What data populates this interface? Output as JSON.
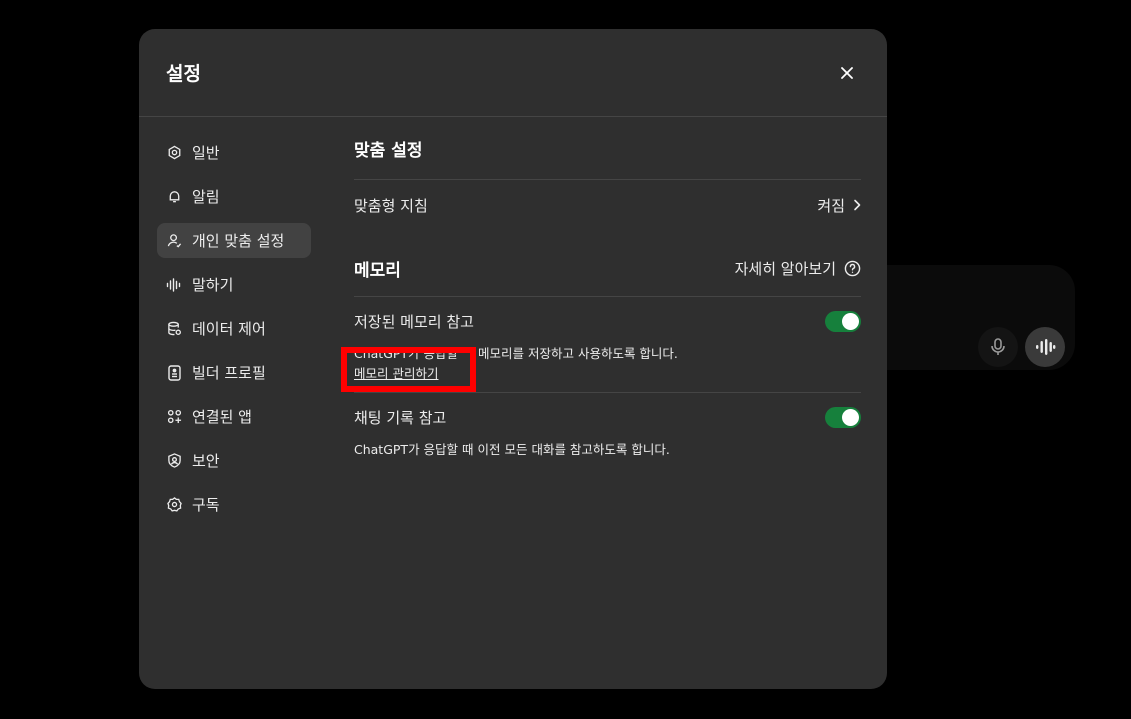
{
  "modal": {
    "title": "설정",
    "close_icon": "close-icon"
  },
  "sidebar": {
    "items": [
      {
        "label": "일반",
        "icon": "gear-icon",
        "active": false
      },
      {
        "label": "알림",
        "icon": "bell-icon",
        "active": false
      },
      {
        "label": "개인 맞춤 설정",
        "icon": "person-icon",
        "active": true
      },
      {
        "label": "말하기",
        "icon": "waveform-icon",
        "active": false
      },
      {
        "label": "데이터 제어",
        "icon": "database-icon",
        "active": false
      },
      {
        "label": "빌더 프로필",
        "icon": "id-card-icon",
        "active": false
      },
      {
        "label": "연결된 앱",
        "icon": "apps-grid-icon",
        "active": false
      },
      {
        "label": "보안",
        "icon": "shield-icon",
        "active": false
      },
      {
        "label": "구독",
        "icon": "subscription-icon",
        "active": false
      }
    ]
  },
  "personalization": {
    "title": "맞춤 설정",
    "custom_instructions_label": "맞춤형 지침",
    "custom_instructions_value": "켜짐"
  },
  "memory": {
    "title": "메모리",
    "learn_more": "자세히 알아보기",
    "saved_memory_label": "저장된 메모리 참고",
    "saved_memory_enabled": true,
    "saved_memory_desc_start": "ChatGPT가 응답할",
    "saved_memory_desc_end": "메모리를 저장하고 사용하도록 합니다.",
    "manage_link": "메모리 관리하기",
    "chat_history_label": "채팅 기록 참고",
    "chat_history_enabled": true,
    "chat_history_desc": "ChatGPT가 응답할 때 이전 모든 대화를 참고하도록 합니다."
  },
  "background": {
    "mic_icon": "microphone-icon",
    "voice_icon": "voice-mode-icon"
  },
  "colors": {
    "toggle_on": "#16803c",
    "highlight": "#ff0000",
    "modal_bg": "#2f2f2f"
  }
}
